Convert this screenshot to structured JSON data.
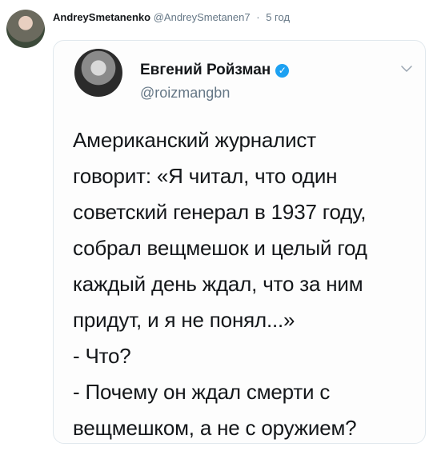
{
  "outer_tweet": {
    "author_name": "AndreySmetanenko",
    "author_handle": "@AndreySmetanen7",
    "separator": "·",
    "time": "5 год"
  },
  "quoted_tweet": {
    "author_name": "Евгений Ройзман",
    "author_handle": "@roizmangbn",
    "verified": true,
    "body_lines": [
      "Американский журналист",
      "говорит: «Я читал, что один",
      "советский генерал в 1937 году,",
      "собрал вещмешок и целый год",
      "каждый день  ждал, что за ним",
      "придут, и я не понял...»",
      "- Что?",
      "- Почему он ждал смерти с",
      "вещмешком, а не с оружием?"
    ]
  },
  "colors": {
    "accent": "#1da1f2",
    "muted_text": "#657786",
    "border": "#e1e8ed"
  }
}
